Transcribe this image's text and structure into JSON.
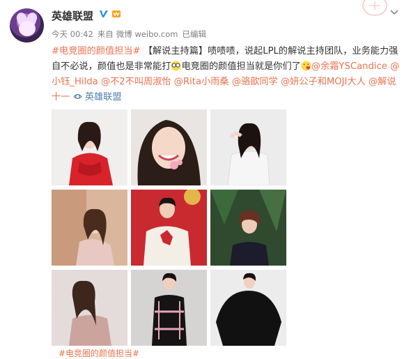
{
  "user": {
    "name": "英雄联盟"
  },
  "meta": {
    "date": "今天 00:42",
    "from_label": "来自",
    "source": "微博 weibo.com",
    "edited": "已编辑"
  },
  "post": {
    "hashtag1": "#电竞圈的颜值担当#",
    "bracket": "【解说主持篇】",
    "text1": "啧啧啧，说起LPL的解说主持团队，业务能力强自不必说，颜值也是非常能打",
    "text2": "电竞圈的颜值担当就是你们了",
    "mention1": "@余霜YSCandice",
    "mention2": "@小钰_Hilda",
    "mention3": "@不2不叫周淑怡",
    "mention4": "@Rita小雨桑",
    "mention5": "@骆歆同学",
    "mention6": "@妍公子和MOJI大人",
    "mention7": "@解说十一",
    "location": "英雄联盟"
  },
  "bottom": {
    "partial": "#电竞圈的颜值担当#"
  },
  "colors": {
    "link": "#eb7350",
    "blue_link": "#507daf",
    "text": "#333333",
    "meta": "#808080"
  },
  "icons": [
    "verified-icon",
    "vip-badge-icon",
    "chevron-down-icon",
    "location-icon",
    "glasses-emoji-icon",
    "kiss-emoji-icon"
  ]
}
